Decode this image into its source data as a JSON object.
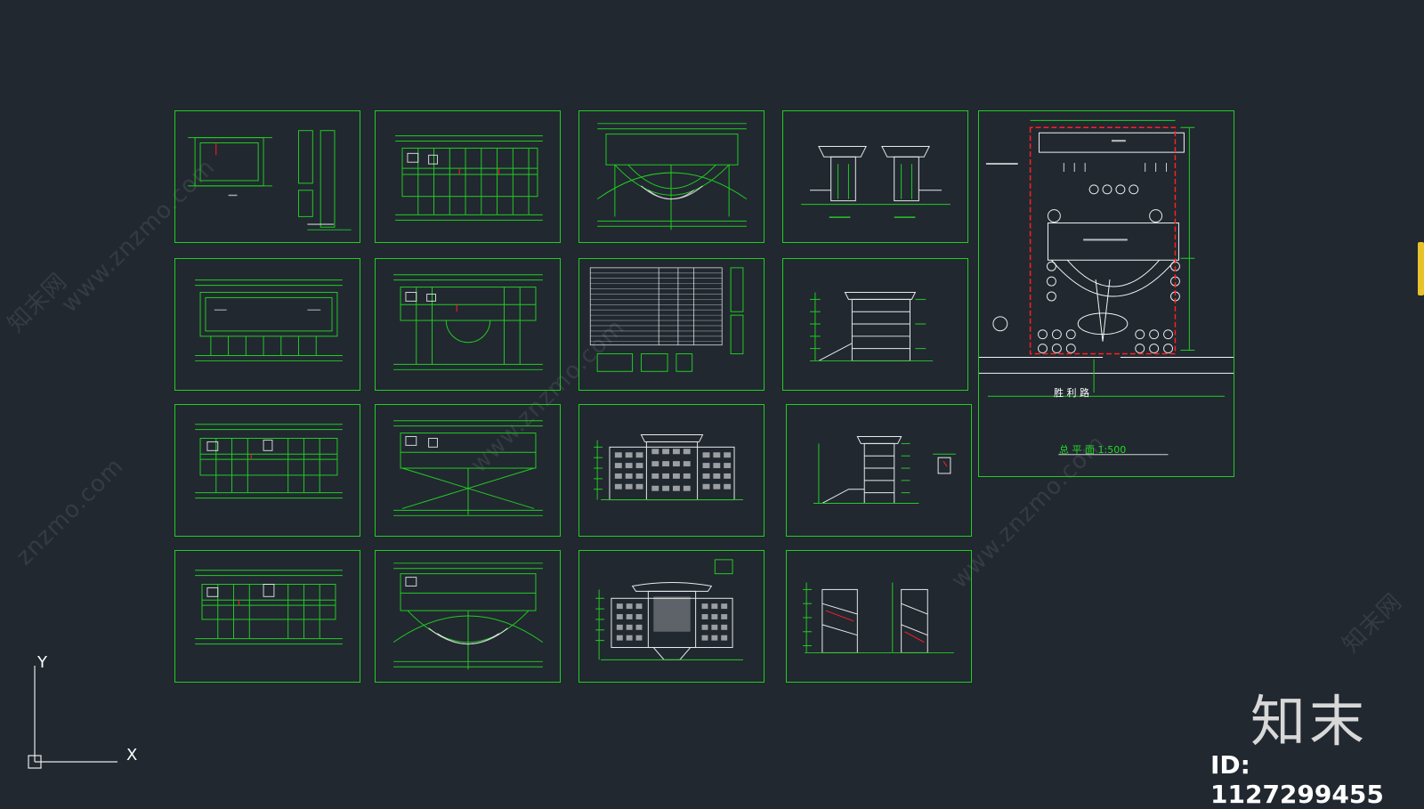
{
  "workspace": {
    "background": "#212830",
    "line_color": "#22cc22",
    "accent_red": "#ff2020"
  },
  "watermark": {
    "text": "znzmo.com",
    "url_text": "www.znzmo.com",
    "cn_text": "知末网"
  },
  "brand": {
    "logo_text": "知末",
    "id_text": "ID: 1127299455"
  },
  "site_plan": {
    "title": "总 平 面    1:500",
    "road_label": "胜 利 路"
  },
  "ucs": {
    "x_label": "X",
    "y_label": "Y"
  },
  "sheets": [
    {
      "id": "sheet-1-1",
      "kind": "floor-plan-details"
    },
    {
      "id": "sheet-1-2",
      "kind": "floor-plan"
    },
    {
      "id": "sheet-1-3",
      "kind": "floor-plan-arc"
    },
    {
      "id": "sheet-1-4",
      "kind": "gate-elevations"
    },
    {
      "id": "sheet-2-1",
      "kind": "roof-plan"
    },
    {
      "id": "sheet-2-2",
      "kind": "floor-plan-semicircle"
    },
    {
      "id": "sheet-2-3",
      "kind": "schedule-table"
    },
    {
      "id": "sheet-2-4",
      "kind": "section"
    },
    {
      "id": "sheet-3-1",
      "kind": "floor-plan"
    },
    {
      "id": "sheet-3-2",
      "kind": "floor-plan-fan"
    },
    {
      "id": "sheet-3-3",
      "kind": "rear-elevation"
    },
    {
      "id": "sheet-3-4",
      "kind": "section-detail"
    },
    {
      "id": "sheet-4-1",
      "kind": "floor-plan"
    },
    {
      "id": "sheet-4-2",
      "kind": "floor-plan-arc"
    },
    {
      "id": "sheet-4-3",
      "kind": "front-elevation"
    },
    {
      "id": "sheet-4-4",
      "kind": "stair-sections"
    },
    {
      "id": "sheet-site",
      "kind": "site-plan"
    }
  ]
}
